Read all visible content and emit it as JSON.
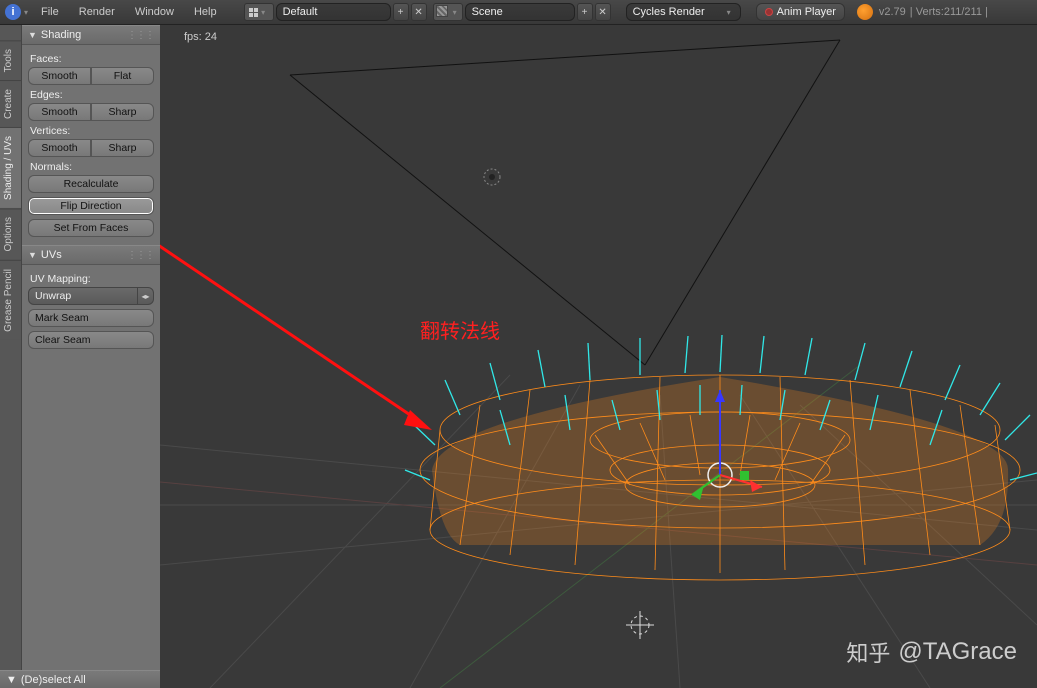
{
  "header": {
    "menus": [
      "File",
      "Render",
      "Window",
      "Help"
    ],
    "layout_name": "Default",
    "scene_name": "Scene",
    "render_engine": "Cycles Render",
    "anim_player": "Anim Player",
    "version": "v2.79",
    "stats": "Verts:211/211"
  },
  "sidebar_tabs": [
    "Tools",
    "Create",
    "Shading / UVs",
    "Options",
    "Grease Pencil"
  ],
  "sidebar_active_tab": "Shading / UVs",
  "panel": {
    "shading": {
      "title": "Shading",
      "faces_label": "Faces:",
      "faces_smooth": "Smooth",
      "faces_flat": "Flat",
      "edges_label": "Edges:",
      "edges_smooth": "Smooth",
      "edges_sharp": "Sharp",
      "vertices_label": "Vertices:",
      "vertices_smooth": "Smooth",
      "vertices_sharp": "Sharp",
      "normals_label": "Normals:",
      "normals_recalculate": "Recalculate",
      "normals_flip": "Flip Direction",
      "normals_setfrom": "Set From Faces"
    },
    "uvs": {
      "title": "UVs",
      "mapping_label": "UV Mapping:",
      "unwrap": "Unwrap",
      "mark_seam": "Mark Seam",
      "clear_seam": "Clear Seam"
    },
    "bottom_panel": "(De)select All"
  },
  "viewport": {
    "fps_label": "fps: 24"
  },
  "annotation": {
    "text": "翻转法线"
  },
  "watermark": {
    "site": "知乎",
    "user": "@TAGrace"
  }
}
